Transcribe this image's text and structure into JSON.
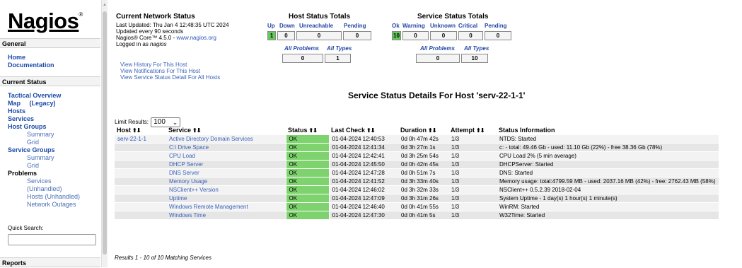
{
  "sidebar": {
    "logo": "Nagios",
    "logo_mark": "®",
    "sections": {
      "general": {
        "title": "General",
        "items": [
          "Home",
          "Documentation"
        ]
      },
      "current_status": {
        "title": "Current Status",
        "items": [
          {
            "label": "Tactical Overview"
          },
          {
            "label": "Map     (Legacy)"
          },
          {
            "label": "Hosts"
          },
          {
            "label": "Services"
          },
          {
            "label": "Host Groups"
          },
          {
            "label": "Summary"
          },
          {
            "label": "Grid"
          },
          {
            "label": "Service Groups"
          },
          {
            "label": "Summary"
          },
          {
            "label": "Grid"
          },
          {
            "label": "Problems"
          },
          {
            "label": "Services"
          },
          {
            "label": "(Unhandled)"
          },
          {
            "label": "Hosts (Unhandled)"
          },
          {
            "label": "Network Outages"
          }
        ]
      },
      "reports": {
        "title": "Reports"
      }
    },
    "quick_search_label": "Quick Search:",
    "quick_search_value": ""
  },
  "network_status": {
    "title": "Current Network Status",
    "last_updated": "Last Updated: Thu Jan 4 12:48:35 UTC 2024",
    "update_interval": "Updated every 90 seconds",
    "version_prefix": "Nagios® Core™ 4.5.0 - ",
    "version_link": "www.nagios.org",
    "logged_in_prefix": "Logged in as ",
    "logged_in_user": "nagios",
    "links": [
      "View History For This Host",
      "View Notifications For This Host",
      "View Service Status Detail For All Hosts"
    ]
  },
  "host_totals": {
    "title": "Host Status Totals",
    "headers": [
      "Up",
      "Down",
      "Unreachable",
      "Pending"
    ],
    "values": [
      "1",
      "0",
      "0",
      "0"
    ],
    "sub_headers": [
      "All Problems",
      "All Types"
    ],
    "sub_values": [
      "0",
      "1"
    ]
  },
  "service_totals": {
    "title": "Service Status Totals",
    "headers": [
      "Ok",
      "Warning",
      "Unknown",
      "Critical",
      "Pending"
    ],
    "values": [
      "10",
      "0",
      "0",
      "0",
      "0"
    ],
    "sub_headers": [
      "All Problems",
      "All Types"
    ],
    "sub_values": [
      "0",
      "10"
    ]
  },
  "details": {
    "title": "Service Status Details For Host 'serv-22-1-1'",
    "limit_label": "Limit Results:",
    "limit_value": "100",
    "columns": [
      "Host",
      "Service",
      "Status",
      "Last Check",
      "Duration",
      "Attempt",
      "Status Information"
    ],
    "rows": [
      {
        "host": "serv-22-1-1",
        "service": "Active Directory Domain Services",
        "status": "OK",
        "last_check": "01-04-2024 12:40:53",
        "duration": "0d 0h 47m 42s",
        "attempt": "1/3",
        "info": "NTDS: Started"
      },
      {
        "host": "",
        "service": "C:\\ Drive Space",
        "status": "OK",
        "last_check": "01-04-2024 12:41:34",
        "duration": "0d 3h 27m 1s",
        "attempt": "1/3",
        "info": "c: - total: 49.46 Gb - used: 11.10 Gb (22%) - free 38.36 Gb (78%)"
      },
      {
        "host": "",
        "service": "CPU Load",
        "status": "OK",
        "last_check": "01-04-2024 12:42:41",
        "duration": "0d 3h 25m 54s",
        "attempt": "1/3",
        "info": "CPU Load 2% (5 min average)"
      },
      {
        "host": "",
        "service": "DHCP Server",
        "status": "OK",
        "last_check": "01-04-2024 12:45:50",
        "duration": "0d 0h 42m 45s",
        "attempt": "1/3",
        "info": "DHCPServer: Started"
      },
      {
        "host": "",
        "service": "DNS Server",
        "status": "OK",
        "last_check": "01-04-2024 12:47:28",
        "duration": "0d 0h 51m 7s",
        "attempt": "1/3",
        "info": "DNS: Started"
      },
      {
        "host": "",
        "service": "Memory Usage",
        "status": "OK",
        "last_check": "01-04-2024 12:41:52",
        "duration": "0d 3h 33m 40s",
        "attempt": "1/3",
        "info": "Memory usage: total:4799.59 MB - used: 2037.16 MB (42%) - free: 2762.43 MB (58%)"
      },
      {
        "host": "",
        "service": "NSClient++ Version",
        "status": "OK",
        "last_check": "01-04-2024 12:46:02",
        "duration": "0d 3h 32m 33s",
        "attempt": "1/3",
        "info": "NSClient++ 0.5.2.39 2018-02-04"
      },
      {
        "host": "",
        "service": "Uptime",
        "status": "OK",
        "last_check": "01-04-2024 12:47:09",
        "duration": "0d 3h 31m 26s",
        "attempt": "1/3",
        "info": "System Uptime - 1 day(s) 1 hour(s) 1 minute(s)"
      },
      {
        "host": "",
        "service": "Windows Remote Management",
        "status": "OK",
        "last_check": "01-04-2024 12:46:40",
        "duration": "0d 0h 41m 55s",
        "attempt": "1/3",
        "info": "WinRM: Started"
      },
      {
        "host": "",
        "service": "Windows Time",
        "status": "OK",
        "last_check": "01-04-2024 12:47:30",
        "duration": "0d 0h 41m 5s",
        "attempt": "1/3",
        "info": "W32Time: Started"
      }
    ],
    "results_text": "Results 1 - 10 of 10 Matching Services"
  },
  "colors": {
    "ok": "#7ed36f",
    "link": "#2a55b8",
    "green_total": "#66c95c"
  }
}
